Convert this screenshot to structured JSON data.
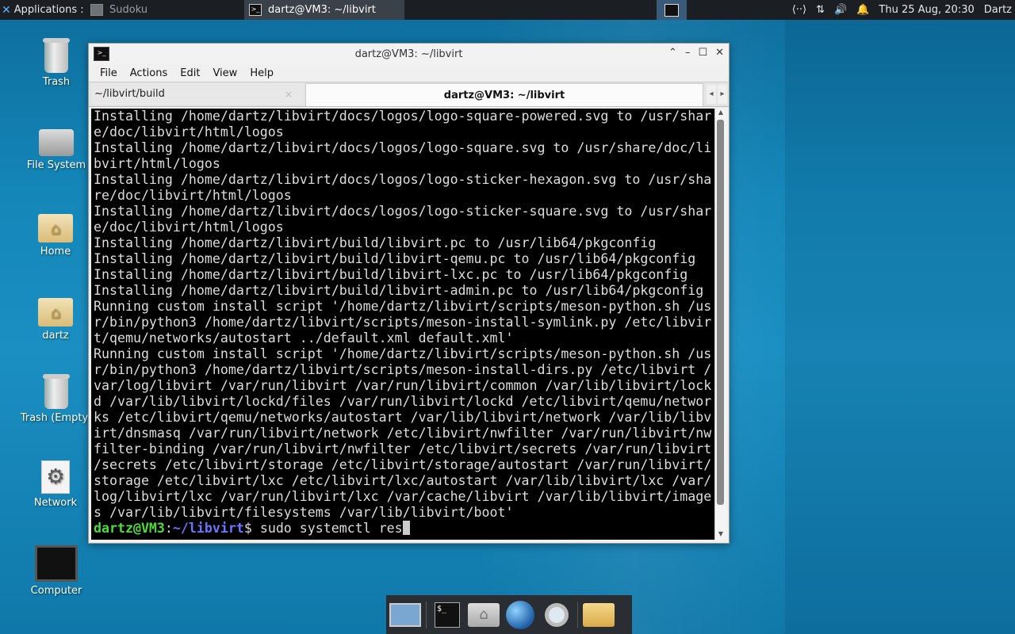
{
  "panel": {
    "applications_label": "Applications :",
    "tasks": [
      {
        "label": "Sudoku"
      },
      {
        "label": "dartz@VM3: ~/libvirt"
      }
    ],
    "clock": "Thu 25 Aug, 20:30",
    "user": "Dartz",
    "tray_icons": [
      "network-icon",
      "transfer-icon",
      "volume-icon",
      "notification-bell-icon"
    ]
  },
  "desktop": {
    "icons": [
      {
        "label": "Trash"
      },
      {
        "label": "File System"
      },
      {
        "label": "Home"
      },
      {
        "label": "dartz"
      },
      {
        "label": "Trash (Empty)"
      },
      {
        "label": "Network"
      },
      {
        "label": "Computer"
      }
    ]
  },
  "window": {
    "title": "dartz@VM3: ~/libvirt",
    "menu": [
      "File",
      "Actions",
      "Edit",
      "View",
      "Help"
    ],
    "tabs": [
      {
        "label": "~/libvirt/build",
        "close": "×"
      },
      {
        "label": "dartz@VM3: ~/libvirt"
      }
    ]
  },
  "terminal": {
    "lines": [
      "Installing /home/dartz/libvirt/docs/logos/logo-square-powered.svg to /usr/shar",
      "e/doc/libvirt/html/logos",
      "Installing /home/dartz/libvirt/docs/logos/logo-square.svg to /usr/share/doc/li",
      "bvirt/html/logos",
      "Installing /home/dartz/libvirt/docs/logos/logo-sticker-hexagon.svg to /usr/sha",
      "re/doc/libvirt/html/logos",
      "Installing /home/dartz/libvirt/docs/logos/logo-sticker-square.svg to /usr/shar",
      "e/doc/libvirt/html/logos",
      "Installing /home/dartz/libvirt/build/libvirt.pc to /usr/lib64/pkgconfig",
      "Installing /home/dartz/libvirt/build/libvirt-qemu.pc to /usr/lib64/pkgconfig",
      "Installing /home/dartz/libvirt/build/libvirt-lxc.pc to /usr/lib64/pkgconfig",
      "Installing /home/dartz/libvirt/build/libvirt-admin.pc to /usr/lib64/pkgconfig",
      "Running custom install script '/home/dartz/libvirt/scripts/meson-python.sh /us",
      "r/bin/python3 /home/dartz/libvirt/scripts/meson-install-symlink.py /etc/libvir",
      "t/qemu/networks/autostart ../default.xml default.xml'",
      "Running custom install script '/home/dartz/libvirt/scripts/meson-python.sh /us",
      "r/bin/python3 /home/dartz/libvirt/scripts/meson-install-dirs.py /etc/libvirt /",
      "var/log/libvirt /var/run/libvirt /var/run/libvirt/common /var/lib/libvirt/lock",
      "d /var/lib/libvirt/lockd/files /var/run/libvirt/lockd /etc/libvirt/qemu/networ",
      "ks /etc/libvirt/qemu/networks/autostart /var/lib/libvirt/network /var/lib/libv",
      "irt/dnsmasq /var/run/libvirt/network /etc/libvirt/nwfilter /var/run/libvirt/nw",
      "filter-binding /var/run/libvirt/nwfilter /etc/libvirt/secrets /var/run/libvirt",
      "/secrets /etc/libvirt/storage /etc/libvirt/storage/autostart /var/run/libvirt/",
      "storage /etc/libvirt/lxc /etc/libvirt/lxc/autostart /var/lib/libvirt/lxc /var/",
      "log/libvirt/lxc /var/run/libvirt/lxc /var/cache/libvirt /var/lib/libvirt/image",
      "s /var/lib/libvirt/filesystems /var/lib/libvirt/boot'"
    ],
    "prompt_user": "dartz@VM3",
    "prompt_sep": ":",
    "prompt_path": "~/libvirt",
    "prompt_symbol": "$",
    "command": " sudo systemctl res"
  },
  "dock": {
    "items": [
      "show-desktop-icon",
      "terminal-icon",
      "file-manager-icon",
      "web-browser-icon",
      "app-finder-icon",
      "folder-icon"
    ],
    "terminal_glyph": "$_"
  }
}
